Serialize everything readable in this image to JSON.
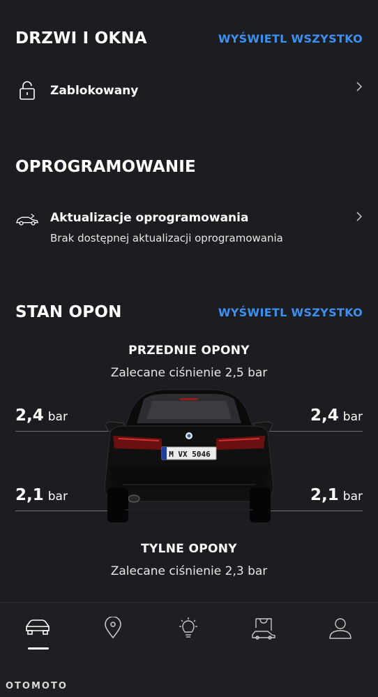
{
  "doors": {
    "title": "DRZWI I OKNA",
    "view_all": "WYŚWIETL WSZYSTKO",
    "status_icon": "padlock-icon",
    "status": "Zablokowany"
  },
  "software": {
    "title": "OPROGRAMOWANIE",
    "icon": "car-update-icon",
    "label": "Aktualizacje oprogramowania",
    "sublabel": "Brak dostępnej aktualizacji oprogramowania"
  },
  "tyres": {
    "title": "STAN OPON",
    "view_all": "WYŚWIETL WSZYSTKO",
    "front_title": "PRZEDNIE OPONY",
    "front_recommended": "Zalecane ciśnienie 2,5 bar",
    "rear_title": "TYLNE OPONY",
    "rear_recommended": "Zalecane ciśnienie 2,3 bar",
    "front_left": {
      "value": "2,4",
      "unit": "bar"
    },
    "front_right": {
      "value": "2,4",
      "unit": "bar"
    },
    "rear_left": {
      "value": "2,1",
      "unit": "bar"
    },
    "rear_right": {
      "value": "2,1",
      "unit": "bar"
    },
    "plate": "M VX 5046"
  },
  "nav": {
    "items": [
      "car-icon",
      "location-pin-icon",
      "lightbulb-icon",
      "shopping-bag-car-icon",
      "profile-icon"
    ],
    "active": 0
  },
  "watermark": "OTOMOTO",
  "colors": {
    "background": "#1c1d20",
    "accent": "#3d8ff0",
    "text": "#ffffff"
  }
}
